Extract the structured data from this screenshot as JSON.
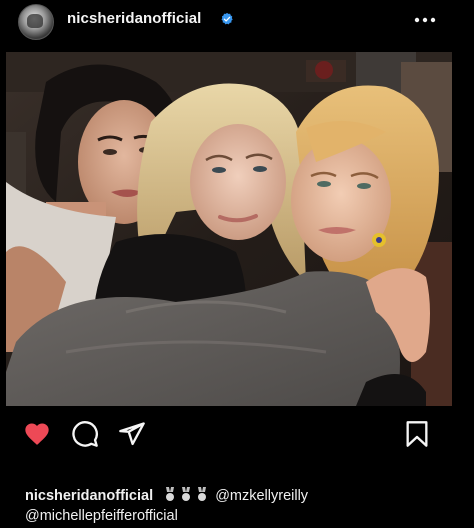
{
  "post": {
    "username": "nicsheridanofficial",
    "verified_icon": "verified-badge-icon",
    "more_icon": "more-dots-icon",
    "photo_alt": "",
    "actions": {
      "like_icon": "heart-filled-icon",
      "comment_icon": "comment-icon",
      "share_icon": "send-icon",
      "save_icon": "bookmark-icon"
    },
    "caption": {
      "user": "nicsheridanofficial",
      "mention_1": "@mzkellyreilly",
      "mention_2": "@michellepfeifferofficial"
    }
  },
  "colors": {
    "background": "#000000",
    "verified_blue": "#3897f0",
    "like_red": "#ed4956",
    "text": "#f5f5f5"
  }
}
